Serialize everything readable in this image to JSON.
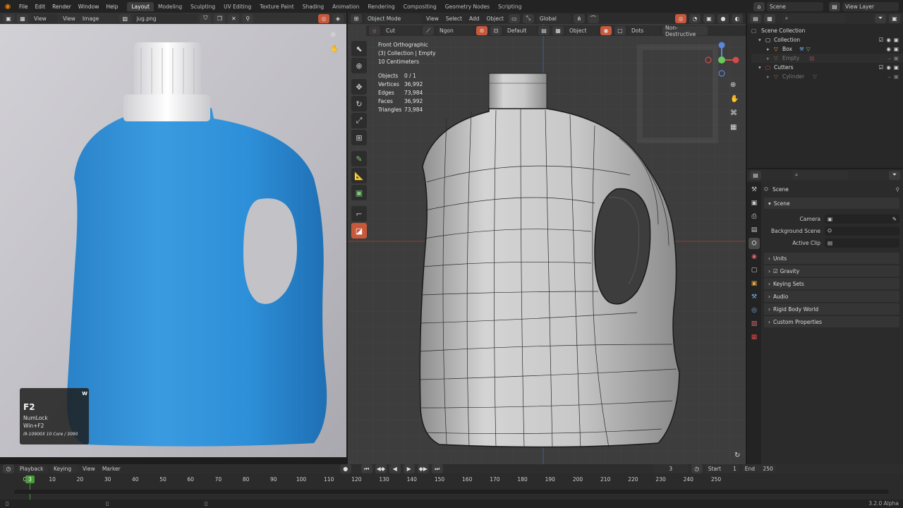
{
  "menu": [
    "File",
    "Edit",
    "Render",
    "Window",
    "Help"
  ],
  "workspaces": [
    "Layout",
    "Modeling",
    "Sculpting",
    "UV Editing",
    "Texture Paint",
    "Shading",
    "Animation",
    "Rendering",
    "Compositing",
    "Geometry Nodes",
    "Scripting"
  ],
  "active_workspace": "Layout",
  "scene": "Scene",
  "view_layer": "View Layer",
  "image_editor": {
    "menus": [
      "View",
      "View",
      "Image"
    ],
    "image_name": "jug.png",
    "keyhint": {
      "key": "F2",
      "line1": "NumLock",
      "line2": "Win+F2",
      "hw": "i9-10900X 10 Core / 3090",
      "badge": "W"
    }
  },
  "viewport": {
    "mode": "Object Mode",
    "menus": [
      "View",
      "Select",
      "Add",
      "Object"
    ],
    "orientation": "Global",
    "tool_header": {
      "cut": "Cut",
      "ngon": "Ngon",
      "default": "Default",
      "object": "Object",
      "dots": "Dots",
      "nondestructive": "Non-Destructive"
    },
    "overlay": {
      "view": "Front Orthographic",
      "collection": "(3) Collection | Empty",
      "scale": "10 Centimeters",
      "stats": [
        {
          "label": "Objects",
          "value": "0 / 1"
        },
        {
          "label": "Vertices",
          "value": "36,992"
        },
        {
          "label": "Edges",
          "value": "73,984"
        },
        {
          "label": "Faces",
          "value": "36,992"
        },
        {
          "label": "Triangles",
          "value": "73,984"
        }
      ]
    }
  },
  "outliner": {
    "rows": [
      {
        "label": "Scene Collection",
        "indent": 0,
        "dim": false,
        "color": "#cccccc"
      },
      {
        "label": "Collection",
        "indent": 1,
        "dim": false,
        "color": "#e0e0e0"
      },
      {
        "label": "Box",
        "indent": 2,
        "dim": false,
        "color": "#e0e0e0"
      },
      {
        "label": "Empty",
        "indent": 2,
        "dim": true,
        "color": "#888888"
      },
      {
        "label": "Cutters",
        "indent": 1,
        "dim": false,
        "color": "#e0e0e0"
      },
      {
        "label": "Cylinder",
        "indent": 2,
        "dim": true,
        "color": "#888888"
      }
    ]
  },
  "properties": {
    "title": "Scene",
    "section": "Scene",
    "fields": [
      {
        "label": "Camera"
      },
      {
        "label": "Background Scene"
      },
      {
        "label": "Active Clip"
      }
    ],
    "panels": [
      "Units",
      "Gravity",
      "Keying Sets",
      "Audio",
      "Rigid Body World",
      "Custom Properties"
    ]
  },
  "timeline": {
    "menus": [
      "Playback",
      "Keying",
      "View",
      "Marker"
    ],
    "current_frame": "3",
    "start_label": "Start",
    "start": "1",
    "end_label": "End",
    "end": "250",
    "ticks": [
      "0",
      "10",
      "20",
      "30",
      "40",
      "50",
      "60",
      "70",
      "80",
      "90",
      "100",
      "110",
      "120",
      "130",
      "140",
      "150",
      "160",
      "170",
      "180",
      "190",
      "200",
      "210",
      "220",
      "230",
      "240",
      "250"
    ]
  },
  "status": {
    "version": "3.2.0 Alpha"
  },
  "colors": {
    "accent": "#c8583c",
    "frame_green": "#4a9a3c",
    "bottle_blue": "#2f8fd4"
  }
}
